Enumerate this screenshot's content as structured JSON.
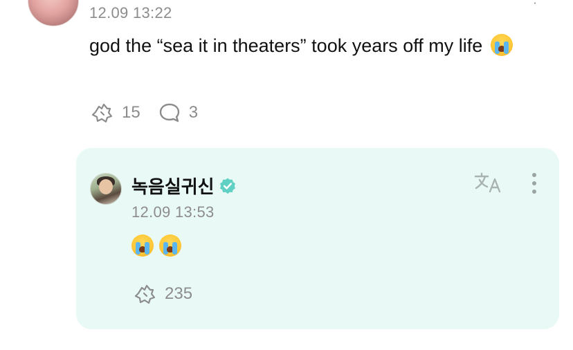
{
  "top_comment": {
    "time": "12.09 13:22",
    "text": "god the “sea it in theaters” took years off my life",
    "emoji": "loudly-crying-face",
    "likes": "15",
    "comments": "3"
  },
  "reply": {
    "author": "녹음실귀신",
    "verified": true,
    "time": "12.09 13:53",
    "emojis": [
      "loudly-crying-face",
      "loudly-crying-face"
    ],
    "likes": "235"
  },
  "icons": {
    "like": "like-icon",
    "comment": "comment-icon",
    "translate": "translate-icon",
    "more": "more-vertical-icon",
    "verified": "verified-badge-icon"
  },
  "colors": {
    "reply_background": "#e9faf6",
    "accent_teal": "#5fd0c3",
    "muted_text": "#8c8c8c"
  }
}
